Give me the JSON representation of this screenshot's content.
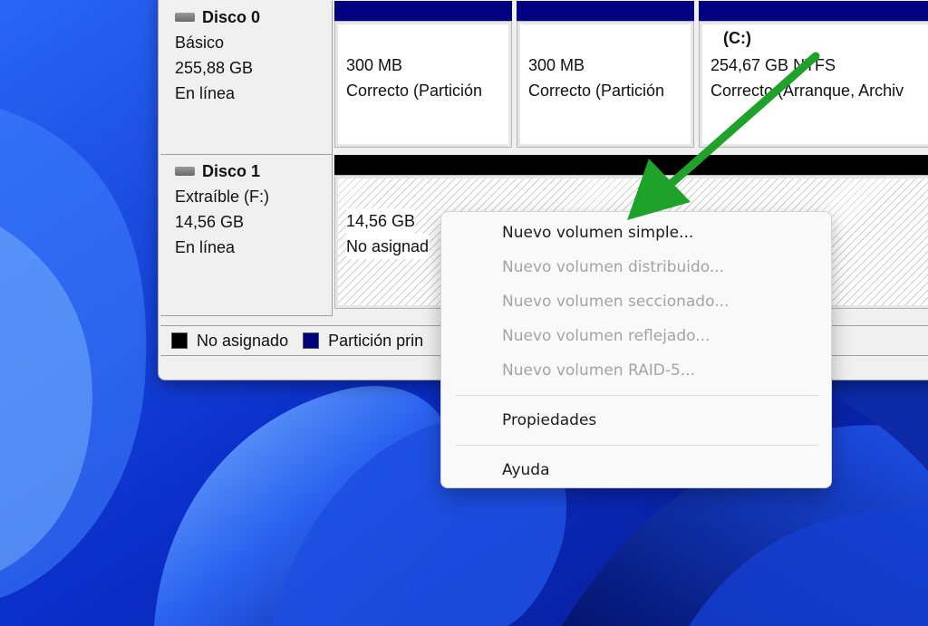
{
  "disks": [
    {
      "name": "Disco 0",
      "type": "Básico",
      "size": "255,88 GB",
      "status": "En línea",
      "partitions": [
        {
          "label": "",
          "size": "300 MB",
          "status": "Correcto (Partición"
        },
        {
          "label": "",
          "size": "300 MB",
          "status": "Correcto (Partición"
        },
        {
          "label": "(C:)",
          "size": "254,67 GB NTFS",
          "status": "Correcto (Arranque, Archiv"
        }
      ]
    },
    {
      "name": "Disco 1",
      "type": "Extraíble (F:)",
      "size": "14,56 GB",
      "status": "En línea",
      "partitions": [
        {
          "size": "14,56 GB",
          "status": "No asignad"
        }
      ]
    }
  ],
  "legend": {
    "unallocated": "No asignado",
    "primary": "Partición prin"
  },
  "colors": {
    "unallocated": "#000000",
    "primary": "#000080",
    "arrow": "#1fa22a"
  },
  "context_menu": {
    "items": [
      {
        "label": "Nuevo volumen simple...",
        "enabled": true
      },
      {
        "label": "Nuevo volumen distribuido...",
        "enabled": false
      },
      {
        "label": "Nuevo volumen seccionado...",
        "enabled": false
      },
      {
        "label": "Nuevo volumen reflejado...",
        "enabled": false
      },
      {
        "label": "Nuevo volumen RAID-5...",
        "enabled": false
      }
    ],
    "properties": "Propiedades",
    "help": "Ayuda"
  }
}
